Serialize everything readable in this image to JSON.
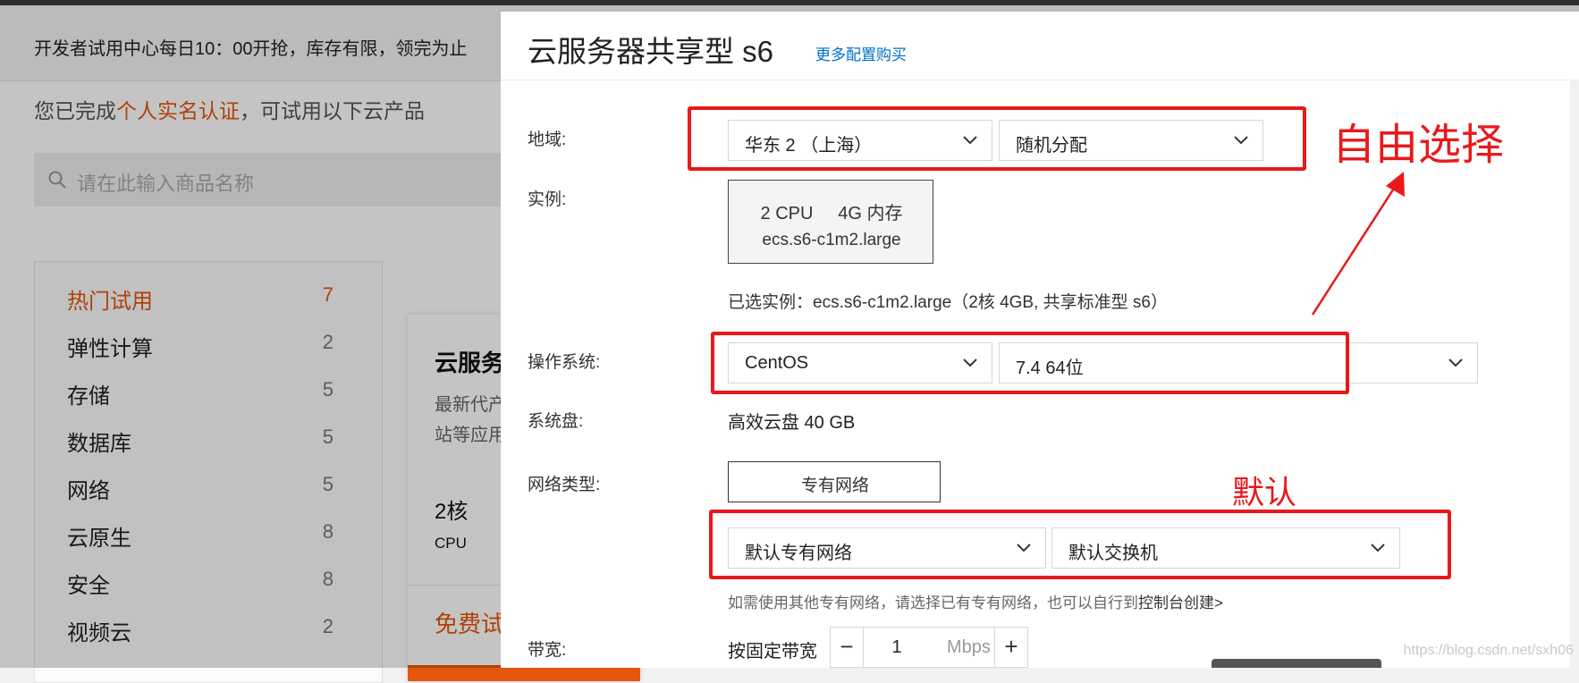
{
  "background": {
    "notice": "开发者试用中心每日10：00开抢，库存有限，领完为止",
    "auth_prefix": "您已完成",
    "auth_link": "个人实名认证",
    "auth_suffix": "，可试用以下云产品",
    "search_placeholder": "请在此输入商品名称",
    "categories": [
      {
        "label": "热门试用",
        "count": "7"
      },
      {
        "label": "弹性计算",
        "count": "2"
      },
      {
        "label": "存储",
        "count": "5"
      },
      {
        "label": "数据库",
        "count": "5"
      },
      {
        "label": "网络",
        "count": "5"
      },
      {
        "label": "云原生",
        "count": "8"
      },
      {
        "label": "安全",
        "count": "8"
      },
      {
        "label": "视频云",
        "count": "2"
      }
    ],
    "card": {
      "title": "云服务",
      "desc": "最新代产\n站等应用",
      "cores": "2核",
      "cpu_label": "CPU",
      "free": "免费试"
    }
  },
  "drawer": {
    "title": "云服务器共享型 s6",
    "more_link": "更多配置购买",
    "region_label": "地域:",
    "region_value": "华东 2 （上海）",
    "zone_value": "随机分配",
    "instance_label": "实例:",
    "instance_spec": "2 CPU     4G 内存",
    "instance_name": "ecs.s6-c1m2.large",
    "selected_instance": "已选实例：ecs.s6-c1m2.large（2核 4GB, 共享标准型 s6）",
    "os_label": "操作系统:",
    "os_value": "CentOS",
    "os_version": "7.4 64位",
    "disk_label": "系统盘:",
    "disk_value": "高效云盘 40 GB",
    "network_label": "网络类型:",
    "network_type": "专有网络",
    "vpc_value": "默认专有网络",
    "vswitch_value": "默认交换机",
    "hint_prefix": "如需使用其他专有网络，请选择已有专有网络，也可以自行到",
    "hint_link": "控制台创建>",
    "bandwidth_label": "带宽:",
    "bandwidth_mode": "按固定带宽",
    "bandwidth_value": "1",
    "bandwidth_unit": "Mbps",
    "minus": "−",
    "plus": "+"
  },
  "annotations": {
    "free_choice": "自由选择",
    "default": "默认"
  },
  "watermark": "https://blog.csdn.net/sxh06",
  "colors": {
    "accent": "#e6550d",
    "annotation_red": "#e8191b",
    "link_blue": "#0070cc"
  }
}
